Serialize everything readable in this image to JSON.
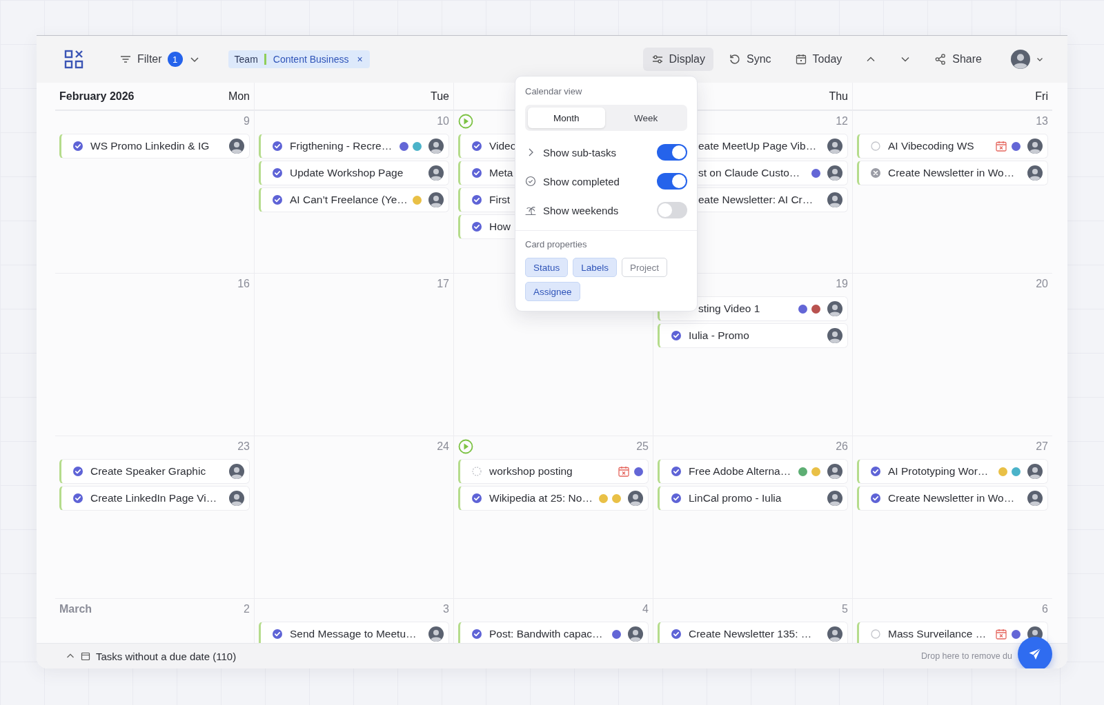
{
  "toolbar": {
    "filter": {
      "label": "Filter",
      "count": "1"
    },
    "chip": {
      "group": "Team",
      "value": "Content Business",
      "remove": "×"
    },
    "display": {
      "label": "Display",
      "selected": true
    },
    "sync": "Sync",
    "today": "Today",
    "share": "Share"
  },
  "calendar": {
    "title": "February 2026",
    "weeks": [
      {
        "days": [
          {
            "weekday": "Mon",
            "number": "9",
            "tasks": [
              {
                "title": "WS Promo Linkedin & IG",
                "kind": "done",
                "avatar": true
              }
            ]
          },
          {
            "weekday": "Tue",
            "number": "10",
            "tasks": [
              {
                "title": "Frigthening - Recre…",
                "kind": "done",
                "dots": [
                  {
                    "color": "#6366d6"
                  },
                  {
                    "color": "#4bb3c9"
                  }
                ],
                "avatar": true
              },
              {
                "title": "Update Workshop Page",
                "kind": "done",
                "avatar": true
              },
              {
                "title": "AI Can’t Freelance (Ye…",
                "kind": "done",
                "dots": [
                  {
                    "color": "#e9c046"
                  }
                ],
                "avatar": true
              }
            ]
          },
          {
            "play_marker": true,
            "tasks": [
              {
                "title": "Video",
                "kind": "done"
              },
              {
                "title": "Meta",
                "kind": "done"
              },
              {
                "title": "First",
                "kind": "done"
              },
              {
                "title": "How",
                "kind": "done"
              }
            ]
          },
          {
            "weekday": "Thu",
            "number": "12",
            "tasks": [
              {
                "title": "eate MeetUp Page Vib…",
                "kind": "cut",
                "avatar": true
              },
              {
                "title": "st on Claude Custo…",
                "kind": "cut",
                "dots": [
                  {
                    "color": "#6366d6"
                  }
                ],
                "avatar": true
              },
              {
                "title": "eate Newsletter: AI Cr…",
                "kind": "cut",
                "avatar": true
              }
            ]
          },
          {
            "weekday": "Fri",
            "number": "13",
            "tasks": [
              {
                "title": "AI Vibecoding WS",
                "kind": "todo",
                "overdue": true,
                "dots": [
                  {
                    "color": "#6366d6"
                  }
                ],
                "avatar": true
              },
              {
                "title": "Create Newsletter in Wo…",
                "kind": "cancelled",
                "avatar": true
              }
            ]
          }
        ]
      },
      {
        "days": [
          {
            "number": "16"
          },
          {
            "number": "17"
          },
          {
            "play_marker": false
          },
          {
            "number": "19",
            "tasks": [
              {
                "title": "sting Video 1",
                "kind": "cut",
                "dots": [
                  {
                    "color": "#6366d6"
                  },
                  {
                    "color": "#b9524f"
                  }
                ],
                "avatar": true
              },
              {
                "title": "Iulia - Promo",
                "kind": "done",
                "avatar": true
              }
            ]
          },
          {
            "number": "20"
          }
        ]
      },
      {
        "days": [
          {
            "number": "23",
            "tasks": [
              {
                "title": "Create Speaker Graphic",
                "kind": "done",
                "avatar": true
              },
              {
                "title": "Create LinkedIn Page Vi…",
                "kind": "done",
                "avatar": true
              }
            ]
          },
          {
            "number": "24"
          },
          {
            "number": "25",
            "play_marker": true,
            "tasks": [
              {
                "title": "workshop posting",
                "kind": "backlog",
                "overdue": true,
                "dots": [
                  {
                    "color": "#6366d6"
                  }
                ]
              },
              {
                "title": "Wikipedia at 25: No…",
                "kind": "done",
                "dots": [
                  {
                    "color": "#e9c046"
                  },
                  {
                    "color": "#e9c046"
                  }
                ],
                "avatar": true
              }
            ]
          },
          {
            "number": "26",
            "tasks": [
              {
                "title": "Free Adobe Alterna…",
                "kind": "done",
                "dots": [
                  {
                    "color": "#5dae73"
                  },
                  {
                    "color": "#e9c046"
                  }
                ],
                "avatar": true
              },
              {
                "title": "LinCal promo - Iulia",
                "kind": "done",
                "avatar": true
              }
            ]
          },
          {
            "number": "27",
            "tasks": [
              {
                "title": "AI Prototyping Wor…",
                "kind": "done",
                "dots": [
                  {
                    "color": "#e9c046"
                  },
                  {
                    "color": "#4bb3c9"
                  }
                ],
                "avatar": true
              },
              {
                "title": "Create Newsletter in Wo…",
                "kind": "done",
                "avatar": true
              }
            ]
          }
        ]
      },
      {
        "days": [
          {
            "month_label": "March",
            "number": "2"
          },
          {
            "number": "3",
            "tasks": [
              {
                "title": "Send Message to Meetu…",
                "kind": "done",
                "avatar": true
              }
            ]
          },
          {
            "number": "4",
            "tasks": [
              {
                "title": "Post: Bandwith capac…",
                "kind": "done",
                "dots": [
                  {
                    "color": "#6366d6"
                  }
                ],
                "avatar": true
              }
            ]
          },
          {
            "number": "5",
            "tasks": [
              {
                "title": "Create Newsletter 135: …",
                "kind": "done",
                "avatar": true
              }
            ]
          },
          {
            "number": "6",
            "tasks": [
              {
                "title": "Mass Surveilance …",
                "kind": "todo",
                "overdue": true,
                "dots": [
                  {
                    "color": "#6366d6"
                  }
                ],
                "avatar": true
              }
            ]
          }
        ]
      }
    ]
  },
  "display_popover": {
    "view_heading": "Calendar view",
    "views": [
      {
        "label": "Month",
        "selected": true
      },
      {
        "label": "Week",
        "selected": false
      }
    ],
    "options": [
      {
        "kind": "chevron",
        "label": "Show sub-tasks",
        "on": true
      },
      {
        "kind": "check",
        "label": "Show completed",
        "on": true
      },
      {
        "kind": "palm",
        "label": "Show weekends",
        "on": false
      }
    ],
    "properties_heading": "Card properties",
    "properties": [
      {
        "label": "Status",
        "selected": true
      },
      {
        "label": "Labels",
        "selected": true
      },
      {
        "label": "Project",
        "selected": false
      },
      {
        "label": "Assignee",
        "selected": true
      }
    ]
  },
  "footer": {
    "label": "Tasks without a due date (110)",
    "hint": "Drop here to remove du"
  }
}
